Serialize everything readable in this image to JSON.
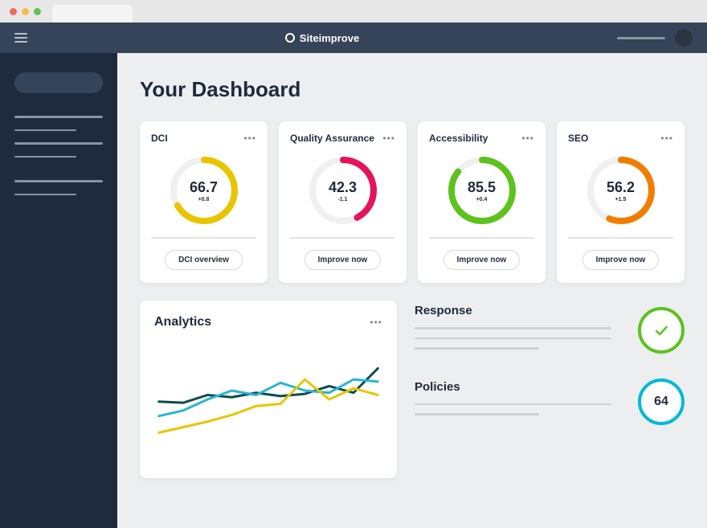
{
  "brand": "Siteimprove",
  "page_title": "Your Dashboard",
  "cards": [
    {
      "title": "DCI",
      "value": "66.7",
      "delta": "+0.8",
      "button": "DCI overview",
      "color": "#e8c500",
      "pct": 0.667
    },
    {
      "title": "Quality Assurance",
      "value": "42.3",
      "delta": "-1.1",
      "button": "Improve now",
      "color": "#e6135a",
      "pct": 0.423
    },
    {
      "title": "Accessibility",
      "value": "85.5",
      "delta": "+0.4",
      "button": "Improve now",
      "color": "#5dc21e",
      "pct": 0.855
    },
    {
      "title": "SEO",
      "value": "56.2",
      "delta": "+1.5",
      "button": "Improve now",
      "color": "#f17d00",
      "pct": 0.562
    }
  ],
  "analytics": {
    "title": "Analytics"
  },
  "response": {
    "title": "Response",
    "status": "ok"
  },
  "policies": {
    "title": "Policies",
    "value": "64"
  },
  "chart_data": {
    "type": "line",
    "x": [
      0,
      1,
      2,
      3,
      4,
      5,
      6,
      7,
      8,
      9
    ],
    "series": [
      {
        "name": "teal-dark",
        "color": "#0e4d4d",
        "values": [
          48,
          47,
          54,
          52,
          56,
          53,
          55,
          62,
          56,
          78
        ]
      },
      {
        "name": "cyan",
        "color": "#27b5d6",
        "values": [
          35,
          40,
          50,
          58,
          54,
          65,
          58,
          56,
          68,
          66
        ]
      },
      {
        "name": "yellow",
        "color": "#e8c500",
        "values": [
          20,
          25,
          30,
          36,
          44,
          46,
          68,
          50,
          60,
          54
        ]
      }
    ],
    "ylim": [
      0,
      100
    ]
  }
}
